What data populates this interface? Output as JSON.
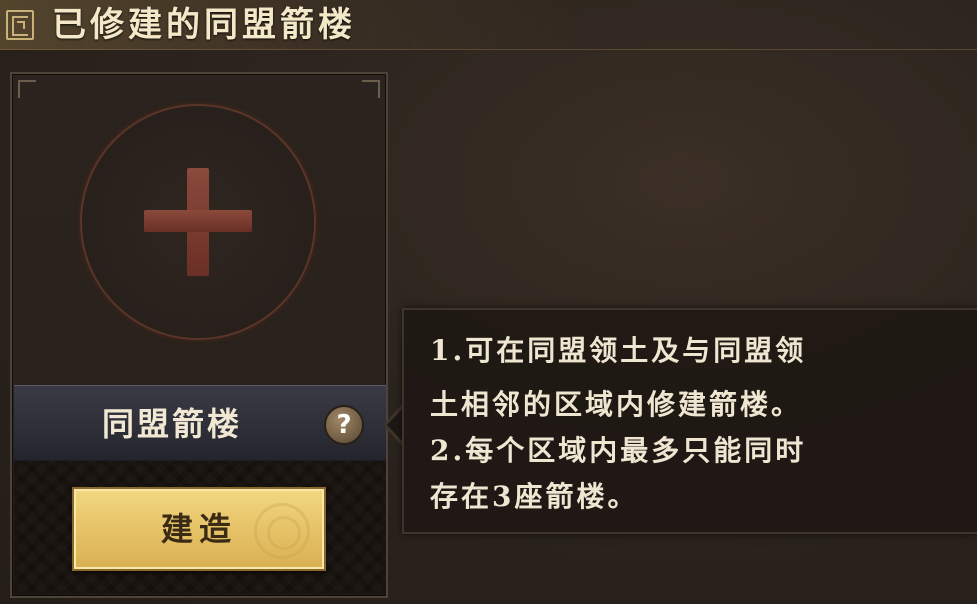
{
  "header": {
    "title": "已修建的同盟箭楼",
    "icon": "fret-pattern-icon"
  },
  "card": {
    "add_icon": "plus-icon",
    "name": "同盟箭楼",
    "help_icon_label": "?",
    "build_button_label": "建造"
  },
  "tooltip": {
    "lines": [
      "1.可在同盟领土及与同盟领",
      "土相邻的区域内修建箭楼。",
      "2.每个区域内最多只能同时",
      "存在3座箭楼。"
    ]
  },
  "colors": {
    "title_text": "#f3e9c8",
    "build_button": "#e6c367",
    "plus": "#7a3d31"
  }
}
